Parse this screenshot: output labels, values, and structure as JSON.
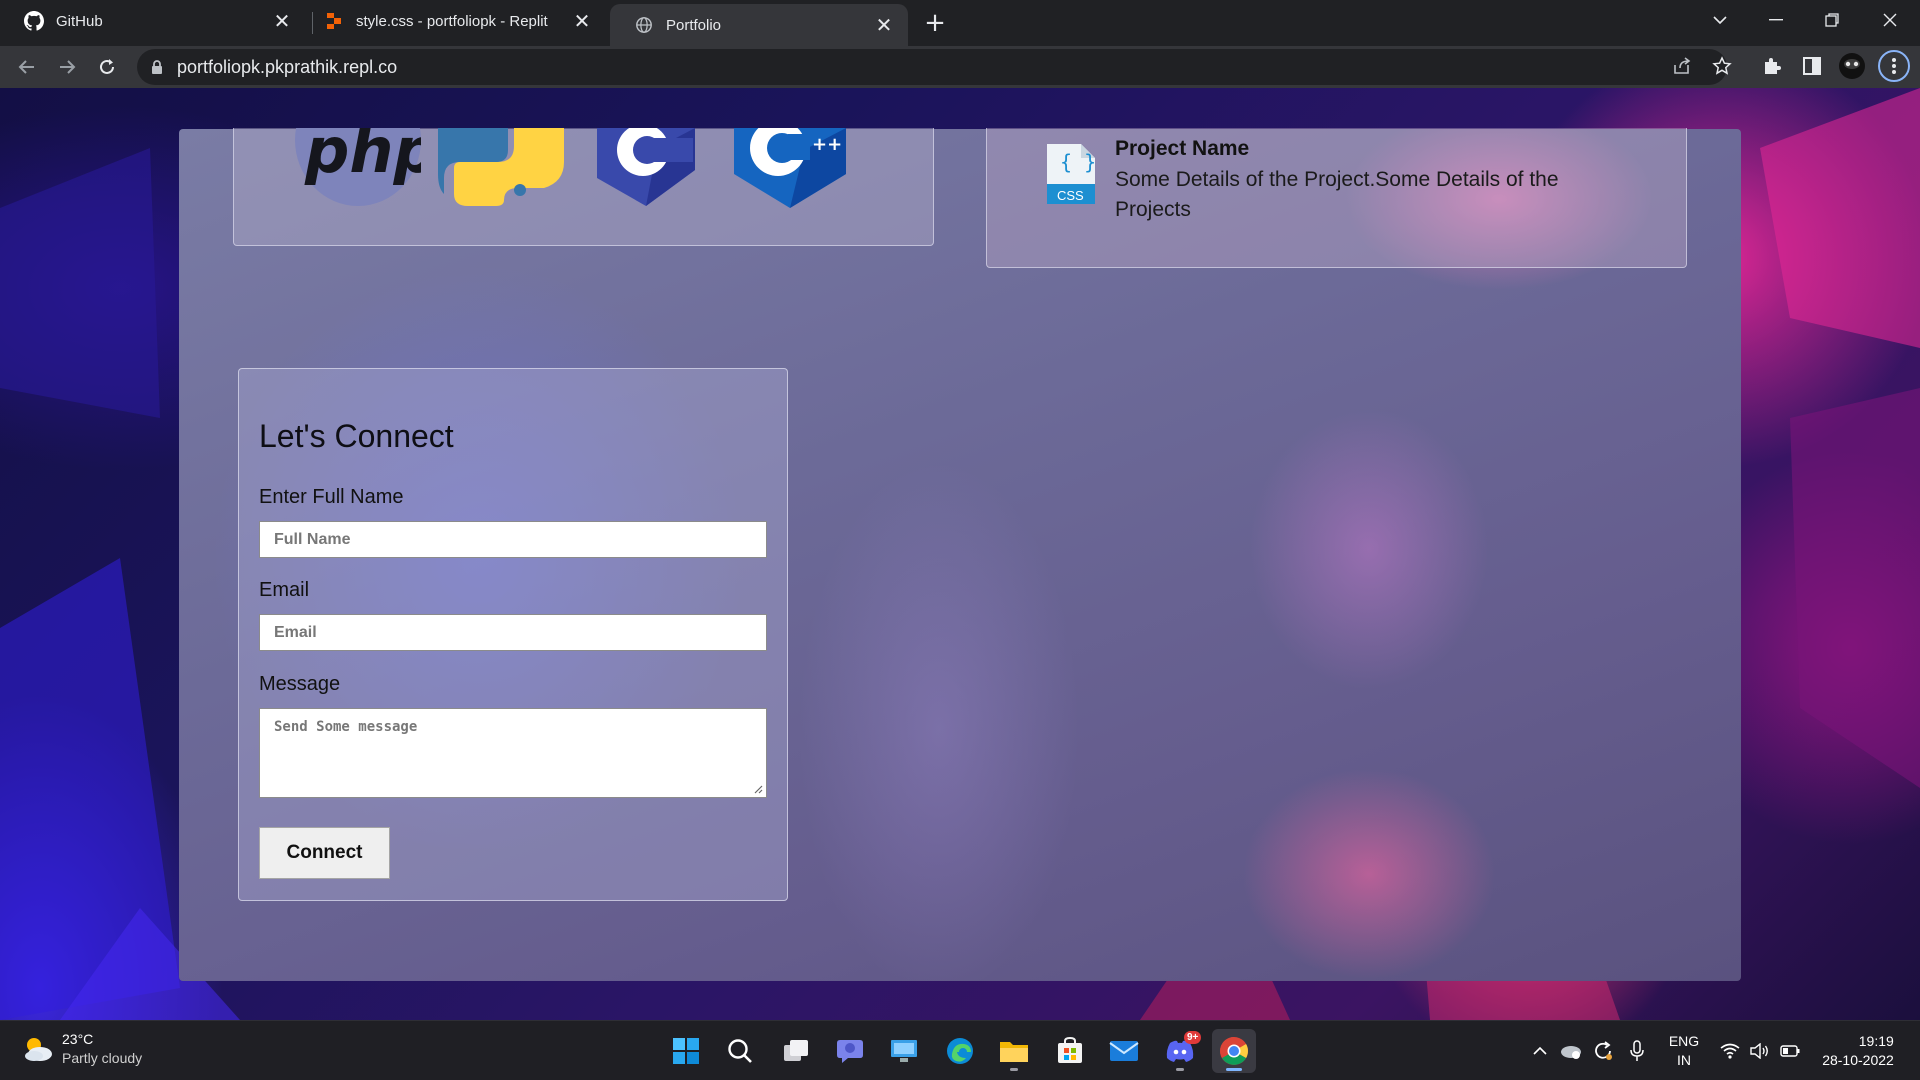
{
  "browser": {
    "tabs": [
      {
        "title": "GitHub",
        "icon": "github-icon"
      },
      {
        "title": "style.css - portfoliopk - Replit",
        "icon": "replit-icon"
      },
      {
        "title": "Portfolio",
        "icon": "globe-icon",
        "active": true
      }
    ],
    "url": "portfoliopk.pkprathik.repl.co"
  },
  "page": {
    "skills": [
      "php",
      "python",
      "c",
      "cpp"
    ],
    "project": {
      "icon_label": "CSS",
      "name": "Project Name",
      "description": "Some Details of the Project.Some Details of the Projects"
    },
    "contact": {
      "title": "Let's Connect",
      "name_label": "Enter Full Name",
      "name_placeholder": "Full Name",
      "email_label": "Email",
      "email_placeholder": "Email",
      "message_label": "Message",
      "message_placeholder": "Send Some message",
      "submit_label": "Connect"
    }
  },
  "taskbar": {
    "weather": {
      "temp": "23°C",
      "condition": "Partly cloudy"
    },
    "apps": [
      "start",
      "search",
      "task-view",
      "teams-chat",
      "desktop",
      "edge",
      "file-explorer",
      "store",
      "mail",
      "discord",
      "chrome"
    ],
    "discord_badge": "9+",
    "lang": {
      "line1": "ENG",
      "line2": "IN"
    },
    "time": "19:19",
    "date": "28-10-2022"
  },
  "colors": {
    "chrome_dark": "#202124",
    "chrome_toolbar": "#35363a",
    "taskbar": "#1f1f24",
    "accent_blue": "#8ab4f8"
  }
}
